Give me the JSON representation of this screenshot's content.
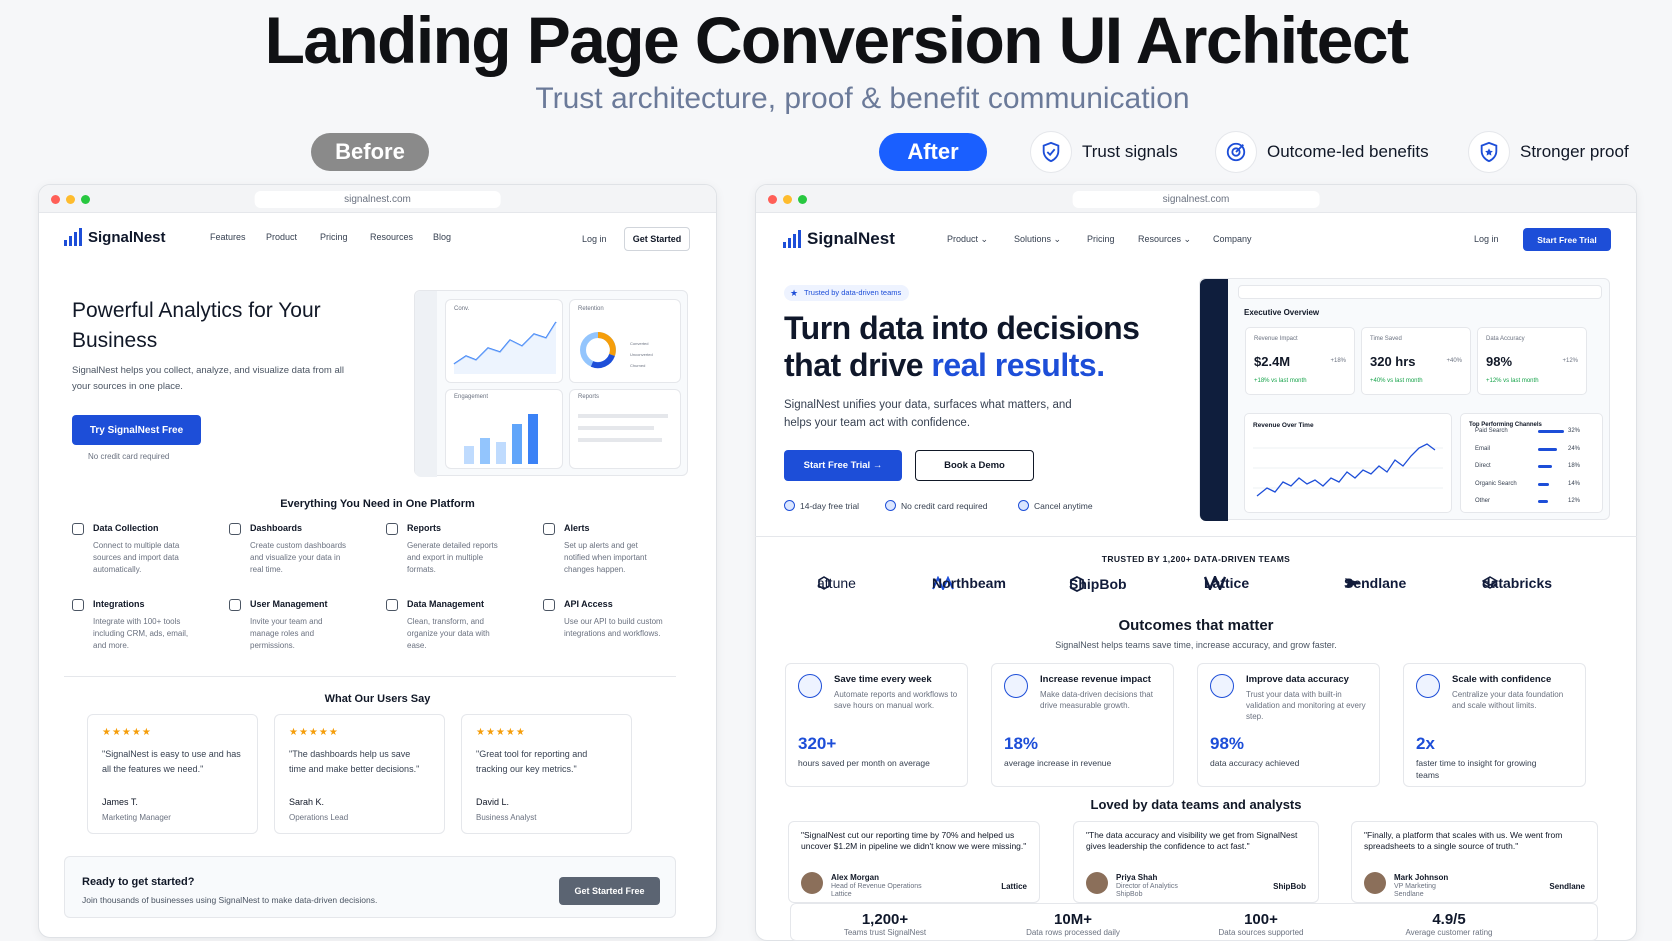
{
  "header": {
    "title": "Landing Page Conversion UI Architect",
    "subtitle": "Trust architecture, proof & benefit communication",
    "before": "Before",
    "after": "After",
    "features": [
      {
        "label": "Trust signals",
        "icon": "shield-check-icon"
      },
      {
        "label": "Outcome-led benefits",
        "icon": "target-icon"
      },
      {
        "label": "Stronger proof",
        "icon": "shield-star-icon"
      }
    ]
  },
  "before": {
    "url": "signalnest.com",
    "brand": "SignalNest",
    "nav": [
      "Features",
      "Product",
      "Pricing",
      "Resources",
      "Blog"
    ],
    "login": "Log in",
    "cta_nav": "Get Started",
    "hero_title": "Powerful Analytics for Your Business",
    "hero_desc": "SignalNest helps you collect, analyze, and visualize data from all your sources in one place.",
    "hero_cta": "Try SignalNest Free",
    "hero_note": "No credit card required",
    "mock": {
      "c1": "Conv.",
      "c2": "Retention",
      "c3": "Engagement",
      "c4": "Reports",
      "legend": [
        "Converted",
        "Unconverted",
        "Churned"
      ],
      "ticks": [
        "Jan",
        "Feb",
        "Mar",
        "Apr",
        "May",
        "Jun",
        "Jul"
      ]
    },
    "features_title": "Everything You Need in One Platform",
    "features": [
      {
        "t": "Data Collection",
        "d": "Connect to multiple data sources and import data automatically."
      },
      {
        "t": "Dashboards",
        "d": "Create custom dashboards and visualize your data in real time."
      },
      {
        "t": "Reports",
        "d": "Generate detailed reports and export in multiple formats."
      },
      {
        "t": "Alerts",
        "d": "Set up alerts and get notified when important changes happen."
      },
      {
        "t": "Integrations",
        "d": "Integrate with 100+ tools including CRM, ads, email, and more."
      },
      {
        "t": "User Management",
        "d": "Invite your team and manage roles and permissions."
      },
      {
        "t": "Data Management",
        "d": "Clean, transform, and organize your data with ease."
      },
      {
        "t": "API Access",
        "d": "Use our API to build custom integrations and workflows."
      }
    ],
    "users_title": "What Our Users Say",
    "stars": "★★★★★",
    "testimonials": [
      {
        "q": "\"SignalNest is easy to use and has all the features we need.\"",
        "n": "James T.",
        "r": "Marketing Manager"
      },
      {
        "q": "\"The dashboards help us save time and make better decisions.\"",
        "n": "Sarah K.",
        "r": "Operations Lead"
      },
      {
        "q": "\"Great tool for reporting and tracking our key metrics.\"",
        "n": "David L.",
        "r": "Business Analyst"
      }
    ],
    "cta_title": "Ready to get started?",
    "cta_desc": "Join thousands of businesses using SignalNest to make data-driven decisions.",
    "cta_btn": "Get Started Free"
  },
  "after": {
    "url": "signalnest.com",
    "brand": "SignalNest",
    "nav": [
      "Product",
      "Solutions",
      "Pricing",
      "Resources",
      "Company"
    ],
    "login": "Log in",
    "cta_nav": "Start Free Trial",
    "badge": "Trusted by data-driven teams",
    "hero_l1": "Turn data into decisions",
    "hero_l2a": "that drive ",
    "hero_l2b": "real results.",
    "hero_desc": "SignalNest unifies your data, surfaces what matters, and helps your team act with confidence.",
    "btn_primary": "Start Free Trial",
    "btn_secondary": "Book a Demo",
    "checks": [
      "14-day free trial",
      "No credit card required",
      "Cancel anytime"
    ],
    "dash": {
      "title": "Executive Overview",
      "kpis": [
        {
          "a": "Revenue Impact",
          "b": "$2.4M",
          "g": "+18%",
          "e": "+18% vs last month"
        },
        {
          "a": "Time Saved",
          "b": "320 hrs",
          "g": "+40%",
          "e": "+40% vs last month"
        },
        {
          "a": "Data Accuracy",
          "b": "98%",
          "g": "+12%",
          "e": "+12% vs last month"
        }
      ],
      "chart_title": "Revenue Over Time",
      "channels_title": "Top Performing Channels",
      "channels": [
        {
          "n": "Paid Search",
          "v": "32%",
          "p": 0.32
        },
        {
          "n": "Email",
          "v": "24%",
          "p": 0.24
        },
        {
          "n": "Direct",
          "v": "18%",
          "p": 0.18
        },
        {
          "n": "Organic Search",
          "v": "14%",
          "p": 0.14
        },
        {
          "n": "Other",
          "v": "12%",
          "p": 0.12
        }
      ]
    },
    "trusted": "TRUSTED BY 1,200+ DATA-DRIVEN TEAMS",
    "logos": [
      "attune",
      "Northbeam",
      "ShipBob",
      "Lattice",
      "Sendlane",
      "databricks"
    ],
    "outcomes_title": "Outcomes that matter",
    "outcomes_sub": "SignalNest helps teams save time, increase accuracy, and grow faster.",
    "outcomes": [
      {
        "h": "Save time every week",
        "d": "Automate reports and workflows to save hours on manual work.",
        "n": "320+",
        "c": "hours saved per month on average"
      },
      {
        "h": "Increase revenue impact",
        "d": "Make data-driven decisions that drive measurable growth.",
        "n": "18%",
        "c": "average increase in revenue"
      },
      {
        "h": "Improve data accuracy",
        "d": "Trust your data with built-in validation and monitoring at every step.",
        "n": "98%",
        "c": "data accuracy achieved"
      },
      {
        "h": "Scale with confidence",
        "d": "Centralize your data foundation and scale without limits.",
        "n": "2x",
        "c": "faster time to insight for growing teams"
      }
    ],
    "loved_title": "Loved by data teams and analysts",
    "reviews": [
      {
        "q": "\"SignalNest cut our reporting time by 70% and helped us uncover $1.2M in pipeline we didn't know we were missing.\"",
        "n": "Alex Morgan",
        "r1": "Head of Revenue Operations",
        "r2": "Lattice",
        "co": "Lattice"
      },
      {
        "q": "\"The data accuracy and visibility we get from SignalNest gives leadership the confidence to act fast.\"",
        "n": "Priya Shah",
        "r1": "Director of Analytics",
        "r2": "ShipBob",
        "co": "ShipBob"
      },
      {
        "q": "\"Finally, a platform that scales with us. We went from spreadsheets to a single source of truth.\"",
        "n": "Mark Johnson",
        "r1": "VP Marketing",
        "r2": "Sendlane",
        "co": "Sendlane"
      }
    ],
    "stats": [
      {
        "v": "1,200+",
        "l": "Teams trust SignalNest"
      },
      {
        "v": "10M+",
        "l": "Data rows processed daily"
      },
      {
        "v": "100+",
        "l": "Data sources supported"
      },
      {
        "v": "4.9/5",
        "l": "Average customer rating"
      }
    ]
  }
}
